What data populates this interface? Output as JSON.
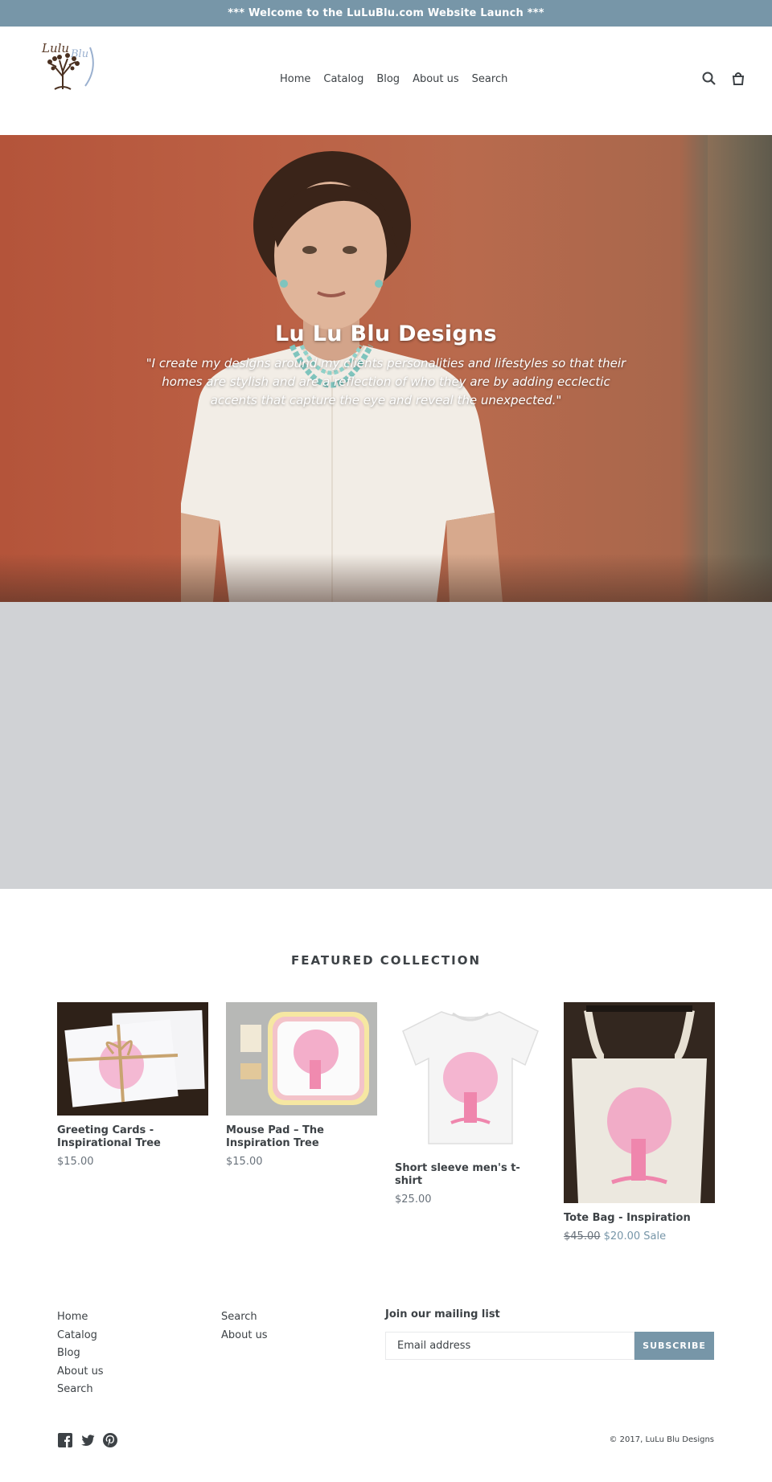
{
  "announcement": "*** Welcome to the LuLuBlu.com Website Launch ***",
  "header": {
    "nav": [
      "Home",
      "Catalog",
      "Blog",
      "About us",
      "Search"
    ],
    "icons": [
      "search-icon",
      "cart-icon"
    ]
  },
  "hero": {
    "title": "Lu Lu Blu Designs",
    "quote": "\"I create my designs around my clients personalities and lifestyles so that their homes are stylish and are a reflection of who they are by adding ecclectic accents that capture the eye and reveal the unexpected.\""
  },
  "featured": {
    "title": "FEATURED COLLECTION",
    "products": [
      {
        "name": "Greeting Cards - Inspirational Tree",
        "price": "$15.00"
      },
      {
        "name": "Mouse Pad – The Inspiration Tree",
        "price": "$15.00"
      },
      {
        "name": "Short sleeve men's t-shirt",
        "price": "$25.00"
      },
      {
        "name": "Tote Bag - Inspiration",
        "old_price": "$45.00",
        "sale_price": "$20.00",
        "sale_label": "Sale"
      }
    ]
  },
  "footer": {
    "col1": [
      "Home",
      "Catalog",
      "Blog",
      "About us",
      "Search"
    ],
    "col2": [
      "Search",
      "About us"
    ],
    "mailing_title": "Join our mailing list",
    "email_placeholder": "Email address",
    "subscribe_label": "SUBSCRIBE",
    "social": [
      "facebook-icon",
      "twitter-icon",
      "pinterest-icon"
    ],
    "copyright": "© 2017, LuLu Blu Designs"
  },
  "colors": {
    "accent": "#7796a8",
    "text": "#3d4246",
    "band": "#d0d2d5"
  }
}
